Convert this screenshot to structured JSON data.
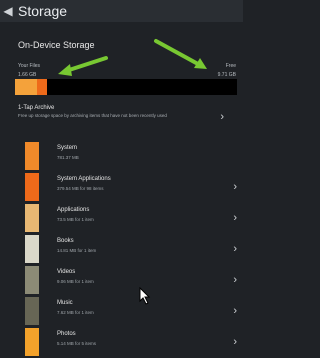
{
  "header": {
    "title": "Storage",
    "back_icon": "back-arrow-icon"
  },
  "section_title": "On-Device Storage",
  "storage": {
    "your_files_label": "Your Files",
    "your_files_size": "1.66 GB",
    "free_label": "Free",
    "free_size": "9.71 GB",
    "used_fraction": 0.146,
    "segments": [
      {
        "name": "orange-light",
        "color": "#f4a23b",
        "fraction": 0.1
      },
      {
        "name": "orange-dark",
        "color": "#ee6a1a",
        "fraction": 0.046
      }
    ],
    "free_color": "#000000"
  },
  "archive": {
    "title": "1-Tap Archive",
    "description": "Free up storage space by archiving items that have not been recently used"
  },
  "rows": [
    {
      "name": "System",
      "sub": "781.37 MB",
      "color": "#f08a2a"
    },
    {
      "name": "System Applications",
      "sub": "379.54 MB for 98 items",
      "color": "#ee6a1a"
    },
    {
      "name": "Applications",
      "sub": "73.5 MB for 1 item",
      "color": "#e8b873"
    },
    {
      "name": "Books",
      "sub": "14.81 MB for 1 item",
      "color": "#dad8c9"
    },
    {
      "name": "Videos",
      "sub": "9.06 MB for 1 item",
      "color": "#8c8b76"
    },
    {
      "name": "Music",
      "sub": "7.62 MB for 1 item",
      "color": "#676655"
    },
    {
      "name": "Photos",
      "sub": "5.14 MB for 5 items",
      "color": "#f3a22b"
    }
  ],
  "colors": {
    "annotation_arrow": "#78c832",
    "background": "#1f2226"
  }
}
